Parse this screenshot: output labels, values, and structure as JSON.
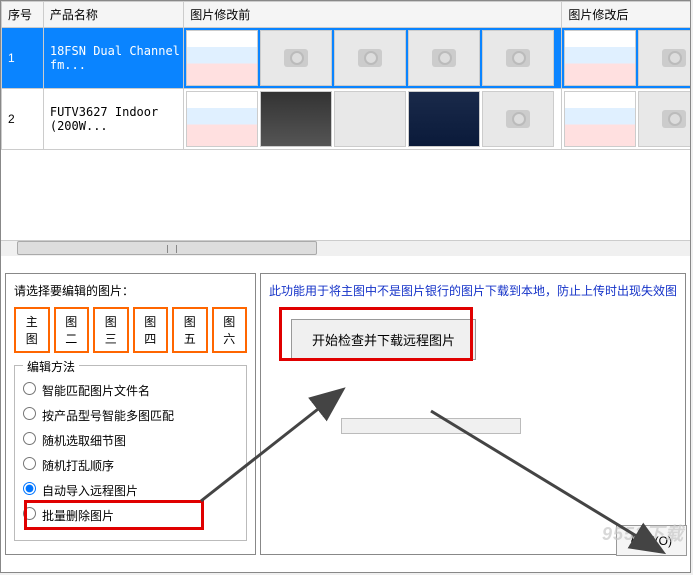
{
  "table": {
    "headers": {
      "seq": "序号",
      "name": "产品名称",
      "before": "图片修改前",
      "after": "图片修改后"
    },
    "rows": [
      {
        "seq": "1",
        "name": "18FSN Dual Channel fm..."
      },
      {
        "seq": "2",
        "name": "FUTV3627 Indoor (200W..."
      }
    ]
  },
  "leftPanel": {
    "title": "请选择要编辑的图片：",
    "tabs": [
      "主图",
      "图二",
      "图三",
      "图四",
      "图五",
      "图六"
    ],
    "methodsLegend": "编辑方法",
    "radios": [
      "智能匹配图片文件名",
      "按产品型号智能多图匹配",
      "随机选取细节图",
      "随机打乱顺序",
      "自动导入远程图片",
      "批量删除图片"
    ],
    "selectedRadio": 4
  },
  "rightPanel": {
    "desc": "此功能用于将主图中不是图片银行的图片下载到本地，防止上传时出现失效图",
    "actionBtn": "开始检查并下载远程图片",
    "confirmBtn": "确定(O)"
  },
  "watermark": "9553下载"
}
